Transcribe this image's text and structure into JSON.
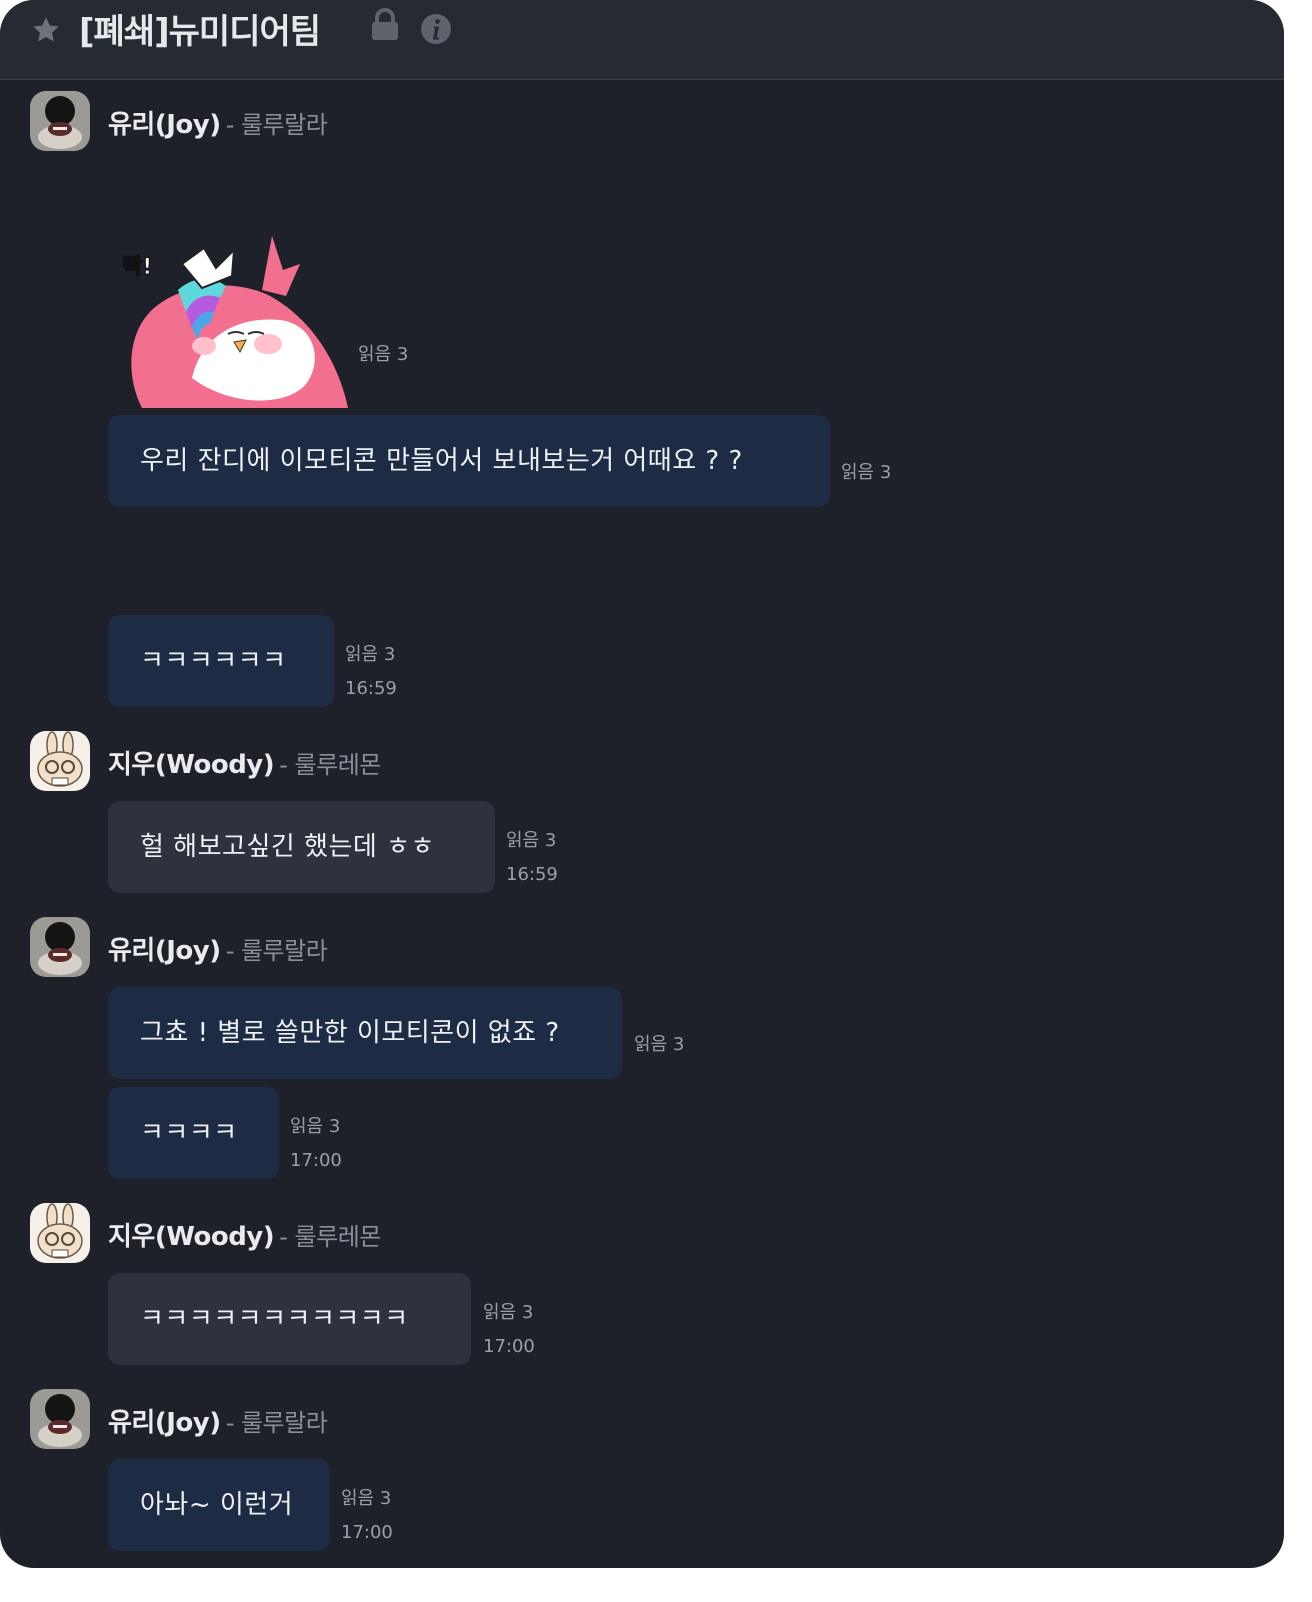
{
  "header": {
    "title": "[폐쇄]뉴미디어팀",
    "icons": [
      "star-icon",
      "lock-icon",
      "info-icon"
    ]
  },
  "people": {
    "yuri": {
      "name": "유리(Joy)",
      "status": "- 룰루랄라"
    },
    "jiu": {
      "name": "지우(Woody)",
      "status": "- 룰루레몬"
    }
  },
  "messages": [
    {
      "sticker_text": "빡!",
      "read": "읽음 3"
    },
    {
      "text": "우리 잔디에 이모티콘 만들어서 보내보는거 어때요 ? ?",
      "read": "읽음 3"
    },
    {
      "text": "ㅋㅋㅋㅋㅋㅋ",
      "read": "읽음 3",
      "time": "16:59"
    },
    {
      "text": "헐 해보고싶긴 했는데 ㅎㅎ",
      "read": "읽음 3",
      "time": "16:59"
    },
    {
      "text": "그쵸 ! 별로 쓸만한 이모티콘이 없죠 ?",
      "read": "읽음 3"
    },
    {
      "text": "ㅋㅋㅋㅋ",
      "read": "읽음 3",
      "time": "17:00"
    },
    {
      "text": "ㅋㅋㅋㅋㅋㅋㅋㅋㅋㅋㅋ",
      "read": "읽음 3",
      "time": "17:00"
    },
    {
      "text": "아놔~ 이런거",
      "read": "읽음 3",
      "time": "17:00"
    }
  ],
  "colors": {
    "background": "#1e2129",
    "header": "#252a33",
    "own_bubble": "#1d2b44",
    "other_bubble": "#2d323c"
  }
}
